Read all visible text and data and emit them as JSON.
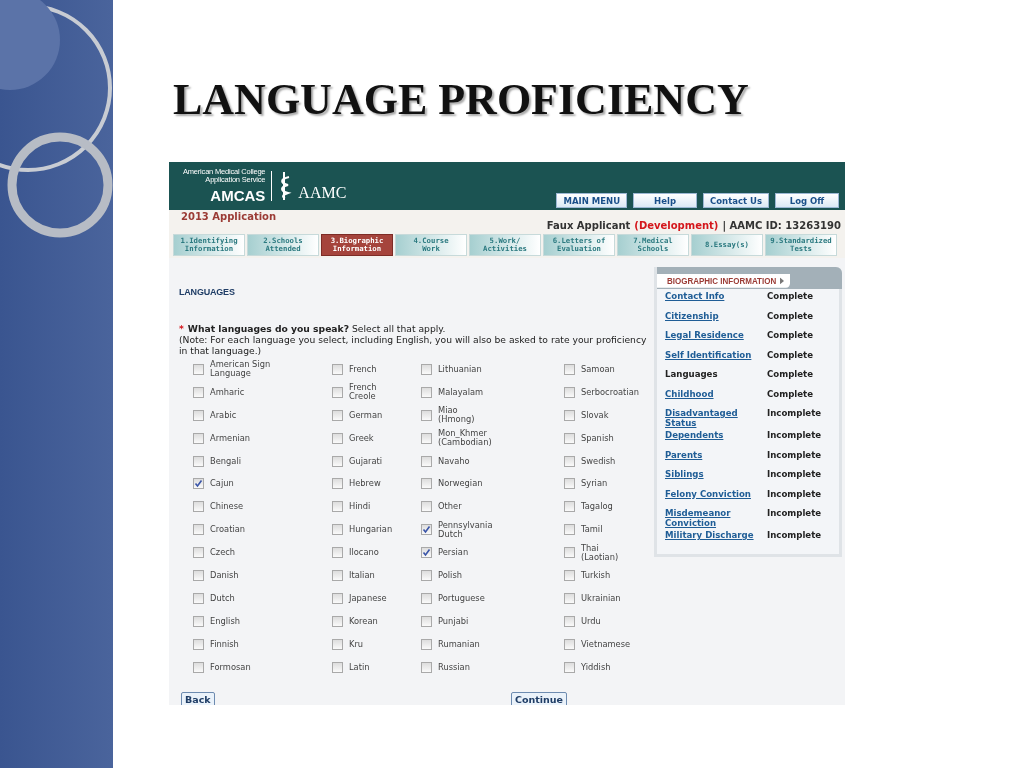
{
  "slide": {
    "title": "LANGUAGE PROFICIENCY"
  },
  "app": {
    "logo": {
      "line1": "American Medical College",
      "line2": "Application Service",
      "amcas": "AMCAS",
      "aamc": "AAMC"
    },
    "nav_buttons": [
      "MAIN MENU",
      "Help",
      "Contact Us",
      "Log Off"
    ],
    "application": "2013 Application",
    "applicant": "Faux Applicant",
    "environment": "(Development)",
    "aamc_id": "| AAMC ID: 13263190",
    "tabs": [
      {
        "label": "1.Identifying\nInformation",
        "selected": false
      },
      {
        "label": "2.Schools\nAttended",
        "selected": false
      },
      {
        "label": "3.Biographic\nInformation",
        "selected": true
      },
      {
        "label": "4.Course\nWork",
        "selected": false
      },
      {
        "label": "5.Work/\nActivities",
        "selected": false
      },
      {
        "label": "6.Letters of\nEvaluation",
        "selected": false
      },
      {
        "label": "7.Medical\nSchools",
        "selected": false
      },
      {
        "label": "8.Essay(s)",
        "selected": false
      },
      {
        "label": "9.Standardized\nTests",
        "selected": false
      }
    ],
    "section_heading": "LANGUAGES",
    "required_mark": "*",
    "question": "**What languages do you speak?** Select all that apply.",
    "note": "(Note: For each language you select, including English, you will also be asked to rate your proficiency in that language.)",
    "languages": [
      {
        "label": "American Sign\nLanguage",
        "checked": false
      },
      {
        "label": "Amharic",
        "checked": false
      },
      {
        "label": "Arabic",
        "checked": false
      },
      {
        "label": "Armenian",
        "checked": false
      },
      {
        "label": "Bengali",
        "checked": false
      },
      {
        "label": "Cajun",
        "checked": true
      },
      {
        "label": "Chinese",
        "checked": false
      },
      {
        "label": "Croatian",
        "checked": false
      },
      {
        "label": "Czech",
        "checked": false
      },
      {
        "label": "Danish",
        "checked": false
      },
      {
        "label": "Dutch",
        "checked": false
      },
      {
        "label": "English",
        "checked": false
      },
      {
        "label": "Finnish",
        "checked": false
      },
      {
        "label": "Formosan",
        "checked": false
      },
      {
        "label": "French",
        "checked": false
      },
      {
        "label": "French\nCreole",
        "checked": false
      },
      {
        "label": "German",
        "checked": false
      },
      {
        "label": "Greek",
        "checked": false
      },
      {
        "label": "Gujarati",
        "checked": false
      },
      {
        "label": "Hebrew",
        "checked": false
      },
      {
        "label": "Hindi",
        "checked": false
      },
      {
        "label": "Hungarian",
        "checked": false
      },
      {
        "label": "Ilocano",
        "checked": false
      },
      {
        "label": "Italian",
        "checked": false
      },
      {
        "label": "Japanese",
        "checked": false
      },
      {
        "label": "Korean",
        "checked": false
      },
      {
        "label": "Kru",
        "checked": false
      },
      {
        "label": "Latin",
        "checked": false
      },
      {
        "label": "Lithuanian",
        "checked": false
      },
      {
        "label": "Malayalam",
        "checked": false
      },
      {
        "label": "Miao\n(Hmong)",
        "checked": false
      },
      {
        "label": "Mon_Khmer\n(Cambodian)",
        "checked": false
      },
      {
        "label": "Navaho",
        "checked": false
      },
      {
        "label": "Norwegian",
        "checked": false
      },
      {
        "label": "Other",
        "checked": false
      },
      {
        "label": "Pennsylvania\nDutch",
        "checked": true
      },
      {
        "label": "Persian",
        "checked": true
      },
      {
        "label": "Polish",
        "checked": false
      },
      {
        "label": "Portuguese",
        "checked": false
      },
      {
        "label": "Punjabi",
        "checked": false
      },
      {
        "label": "Rumanian",
        "checked": false
      },
      {
        "label": "Russian",
        "checked": false
      },
      {
        "label": "Samoan",
        "checked": false
      },
      {
        "label": "Serbocroatian",
        "checked": false
      },
      {
        "label": "Slovak",
        "checked": false
      },
      {
        "label": "Spanish",
        "checked": false
      },
      {
        "label": "Swedish",
        "checked": false
      },
      {
        "label": "Syrian",
        "checked": false
      },
      {
        "label": "Tagalog",
        "checked": false
      },
      {
        "label": "Tamil",
        "checked": false
      },
      {
        "label": "Thai\n(Laotian)",
        "checked": false
      },
      {
        "label": "Turkish",
        "checked": false
      },
      {
        "label": "Ukrainian",
        "checked": false
      },
      {
        "label": "Urdu",
        "checked": false
      },
      {
        "label": "Vietnamese",
        "checked": false
      },
      {
        "label": "Yiddish",
        "checked": false
      }
    ],
    "back_button": "Back",
    "continue_button": "Continue",
    "sidebar": {
      "title": "BIOGRAPHIC INFORMATION",
      "items": [
        {
          "name": "Contact Info",
          "status": "Complete",
          "current": false
        },
        {
          "name": "Citizenship",
          "status": "Complete",
          "current": false
        },
        {
          "name": "Legal Residence",
          "status": "Complete",
          "current": false
        },
        {
          "name": "Self Identification",
          "status": "Complete",
          "current": false
        },
        {
          "name": "Languages",
          "status": "Complete",
          "current": true
        },
        {
          "name": "Childhood",
          "status": "Complete",
          "current": false
        },
        {
          "name": "Disadvantaged Status",
          "status": "Incomplete",
          "current": false
        },
        {
          "name": "Dependents",
          "status": "Incomplete",
          "current": false
        },
        {
          "name": "Parents",
          "status": "Incomplete",
          "current": false
        },
        {
          "name": "Siblings",
          "status": "Incomplete",
          "current": false
        },
        {
          "name": "Felony Conviction",
          "status": "Incomplete",
          "current": false
        },
        {
          "name": "Misdemeanor Conviction",
          "status": "Incomplete",
          "current": false
        },
        {
          "name": "Military Discharge",
          "status": "Incomplete",
          "current": false
        }
      ]
    }
  }
}
